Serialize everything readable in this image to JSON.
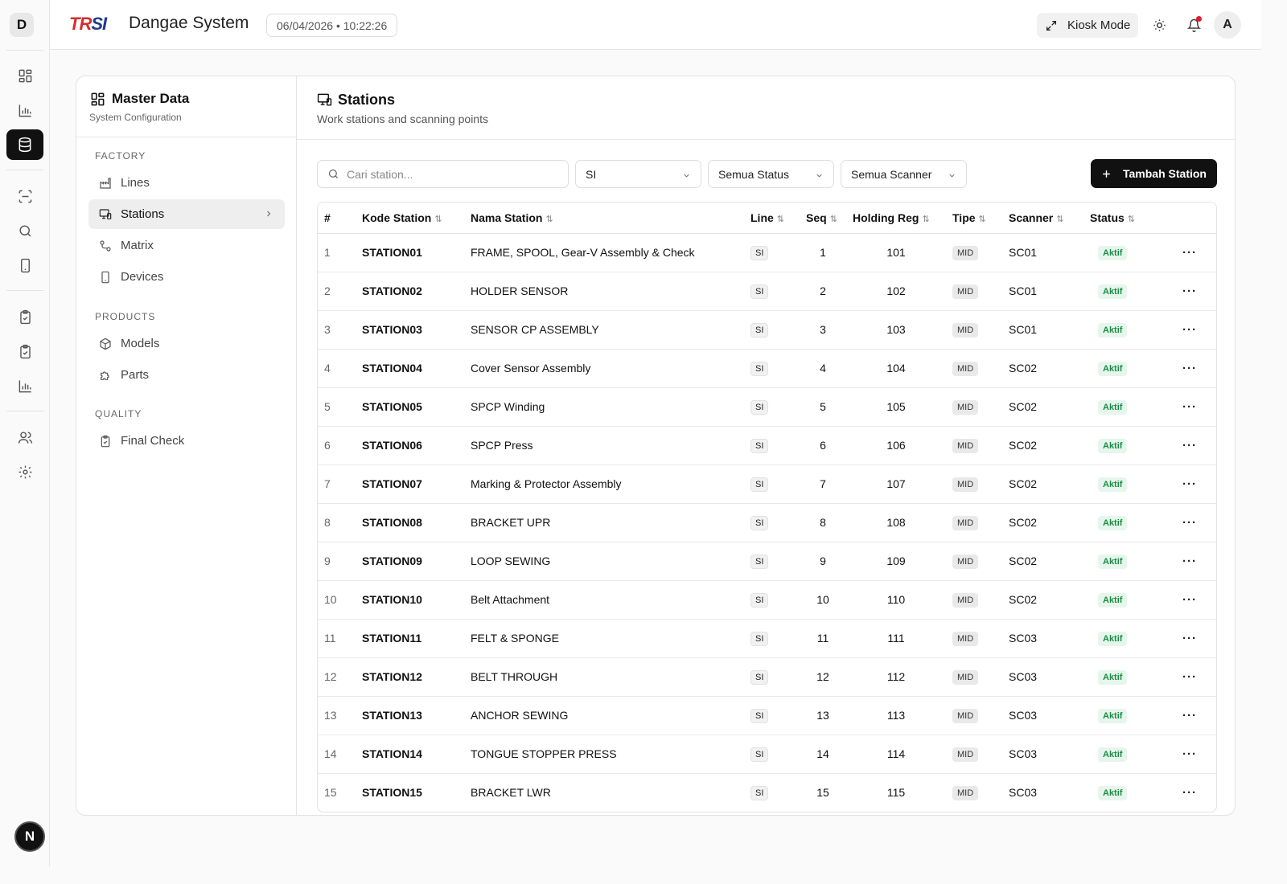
{
  "rail": {
    "logo_letter": "D",
    "user_letter": "N"
  },
  "header": {
    "brand_r": "TR",
    "brand_rest": "SI",
    "app_title": "Dangae System",
    "datetime": "06/04/2026 • 10:22:26",
    "kiosk_label": "Kiosk Mode",
    "avatar_letter": "A",
    "notification_color": "#e11d2a"
  },
  "sidebar": {
    "title": "Master Data",
    "subtitle": "System Configuration",
    "groups": [
      {
        "label": "FACTORY",
        "items": [
          {
            "label": "Lines",
            "icon": "factory-icon"
          },
          {
            "label": "Stations",
            "icon": "monitor-icon",
            "active": true
          },
          {
            "label": "Matrix",
            "icon": "route-icon"
          },
          {
            "label": "Devices",
            "icon": "tablet-icon"
          }
        ]
      },
      {
        "label": "PRODUCTS",
        "items": [
          {
            "label": "Models",
            "icon": "box-icon"
          },
          {
            "label": "Parts",
            "icon": "puzzle-icon"
          }
        ]
      },
      {
        "label": "QUALITY",
        "items": [
          {
            "label": "Final Check",
            "icon": "clipboard-check-icon"
          }
        ]
      }
    ]
  },
  "main": {
    "title": "Stations",
    "subtitle": "Work stations and scanning points",
    "search_placeholder": "Cari station...",
    "filters": {
      "line": "SI",
      "status": "Semua Status",
      "scanner": "Semua Scanner"
    },
    "add_button": "Tambah Station"
  },
  "table": {
    "columns": [
      "#",
      "Kode Station",
      "Nama Station",
      "Line",
      "Seq",
      "Holding Reg",
      "Tipe",
      "Scanner",
      "Status"
    ],
    "rows": [
      {
        "no": "1",
        "code": "STATION01",
        "name": "FRAME, SPOOL, Gear-V Assembly & Check",
        "line": "SI",
        "seq": "1",
        "reg": "101",
        "type": "MID",
        "scanner": "SC01",
        "status": "Aktif"
      },
      {
        "no": "2",
        "code": "STATION02",
        "name": "HOLDER SENSOR",
        "line": "SI",
        "seq": "2",
        "reg": "102",
        "type": "MID",
        "scanner": "SC01",
        "status": "Aktif"
      },
      {
        "no": "3",
        "code": "STATION03",
        "name": "SENSOR CP ASSEMBLY",
        "line": "SI",
        "seq": "3",
        "reg": "103",
        "type": "MID",
        "scanner": "SC01",
        "status": "Aktif"
      },
      {
        "no": "4",
        "code": "STATION04",
        "name": "Cover Sensor Assembly",
        "line": "SI",
        "seq": "4",
        "reg": "104",
        "type": "MID",
        "scanner": "SC02",
        "status": "Aktif"
      },
      {
        "no": "5",
        "code": "STATION05",
        "name": "SPCP Winding",
        "line": "SI",
        "seq": "5",
        "reg": "105",
        "type": "MID",
        "scanner": "SC02",
        "status": "Aktif"
      },
      {
        "no": "6",
        "code": "STATION06",
        "name": "SPCP Press",
        "line": "SI",
        "seq": "6",
        "reg": "106",
        "type": "MID",
        "scanner": "SC02",
        "status": "Aktif"
      },
      {
        "no": "7",
        "code": "STATION07",
        "name": "Marking & Protector Assembly",
        "line": "SI",
        "seq": "7",
        "reg": "107",
        "type": "MID",
        "scanner": "SC02",
        "status": "Aktif"
      },
      {
        "no": "8",
        "code": "STATION08",
        "name": "BRACKET UPR",
        "line": "SI",
        "seq": "8",
        "reg": "108",
        "type": "MID",
        "scanner": "SC02",
        "status": "Aktif"
      },
      {
        "no": "9",
        "code": "STATION09",
        "name": "LOOP SEWING",
        "line": "SI",
        "seq": "9",
        "reg": "109",
        "type": "MID",
        "scanner": "SC02",
        "status": "Aktif"
      },
      {
        "no": "10",
        "code": "STATION10",
        "name": "Belt Attachment",
        "line": "SI",
        "seq": "10",
        "reg": "110",
        "type": "MID",
        "scanner": "SC02",
        "status": "Aktif"
      },
      {
        "no": "11",
        "code": "STATION11",
        "name": "FELT & SPONGE",
        "line": "SI",
        "seq": "11",
        "reg": "111",
        "type": "MID",
        "scanner": "SC03",
        "status": "Aktif"
      },
      {
        "no": "12",
        "code": "STATION12",
        "name": "BELT THROUGH",
        "line": "SI",
        "seq": "12",
        "reg": "112",
        "type": "MID",
        "scanner": "SC03",
        "status": "Aktif"
      },
      {
        "no": "13",
        "code": "STATION13",
        "name": "ANCHOR SEWING",
        "line": "SI",
        "seq": "13",
        "reg": "113",
        "type": "MID",
        "scanner": "SC03",
        "status": "Aktif"
      },
      {
        "no": "14",
        "code": "STATION14",
        "name": "TONGUE STOPPER PRESS",
        "line": "SI",
        "seq": "14",
        "reg": "114",
        "type": "MID",
        "scanner": "SC03",
        "status": "Aktif"
      },
      {
        "no": "15",
        "code": "STATION15",
        "name": "BRACKET LWR",
        "line": "SI",
        "seq": "15",
        "reg": "115",
        "type": "MID",
        "scanner": "SC03",
        "status": "Aktif"
      }
    ],
    "row_action_icon": "more-horizontal-icon"
  },
  "colors": {
    "accent": "#111111",
    "status_bg": "#e6f6ec",
    "status_fg": "#1c8c45",
    "brand_blue": "#1f3a8a",
    "brand_red": "#d62d2d"
  }
}
